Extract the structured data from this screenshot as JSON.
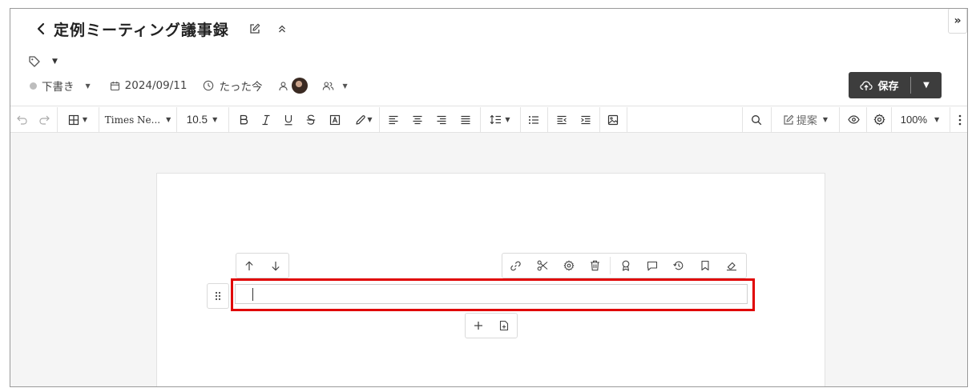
{
  "document": {
    "title": "定例ミーティング議事録"
  },
  "meta": {
    "status": "下書き",
    "date": "2024/09/11",
    "updated": "たった今"
  },
  "save": {
    "label": "保存"
  },
  "toolbar": {
    "font_family": "Times Ne...",
    "font_size": "10.5",
    "suggest": "提案",
    "zoom": "100%"
  },
  "colors": {
    "save_bg": "#3d3d3d",
    "highlight_border": "#e00000",
    "canvas_bg": "#f5f5f5",
    "status_dot": "#bdbdbd"
  },
  "icons": {
    "header": [
      "back-icon",
      "edit-icon",
      "collapse-icon",
      "expand-panel-icon",
      "tag-icon"
    ],
    "meta": [
      "calendar-icon",
      "clock-icon",
      "user-icon",
      "users-icon"
    ],
    "toolbar": [
      "undo-icon",
      "redo-icon",
      "table-icon",
      "bold-icon",
      "italic-icon",
      "underline-icon",
      "strikethrough-icon",
      "text-box-icon",
      "highlighter-icon",
      "align-left-icon",
      "align-center-icon",
      "align-right-icon",
      "align-justify-icon",
      "line-spacing-icon",
      "bullet-list-icon",
      "outdent-icon",
      "indent-icon",
      "image-icon",
      "search-icon",
      "suggest-edit-icon",
      "eye-icon",
      "gear-icon",
      "more-vertical-icon"
    ],
    "block": [
      "arrow-up-icon",
      "arrow-down-icon",
      "link-icon",
      "scissors-icon",
      "gear-icon",
      "trash-icon",
      "award-icon",
      "comment-icon",
      "history-icon",
      "bookmark-icon",
      "eraser-icon",
      "drag-grip-icon",
      "plus-icon",
      "add-page-icon"
    ]
  }
}
